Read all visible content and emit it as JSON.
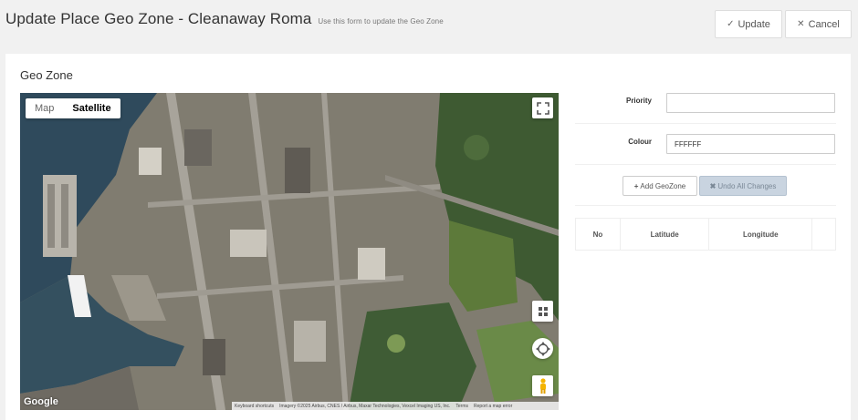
{
  "header": {
    "title": "Update Place Geo Zone - Cleanaway Roma",
    "subtitle": "Use this form to update the Geo Zone",
    "update_label": "Update",
    "cancel_label": "Cancel"
  },
  "card": {
    "title": "Geo Zone"
  },
  "map": {
    "type_options": [
      "Map",
      "Satellite"
    ],
    "selected_type": "Satellite",
    "logo": "Google",
    "attribution": {
      "keyboard": "Keyboard shortcuts",
      "imagery": "Imagery ©2025 Airbus, CNES / Airbus, Maxar Technologies, Vexcel Imaging US, Inc.",
      "terms": "Terms",
      "report": "Report a map error"
    },
    "icons": [
      "fullscreen-icon",
      "tilt-grid-icon",
      "rotate-icon",
      "pegman-icon"
    ]
  },
  "form": {
    "priority_label": "Priority",
    "priority_value": "",
    "colour_label": "Colour",
    "colour_value": "FFFFFF",
    "add_geozone_label": "Add GeoZone",
    "undo_label": "Undo All Changes"
  },
  "table": {
    "columns": [
      "No",
      "Latitude",
      "Longitude",
      ""
    ]
  },
  "colors": {
    "background": "#f1f1f1",
    "card": "#ffffff",
    "undo_button": "#c9d4e0"
  }
}
